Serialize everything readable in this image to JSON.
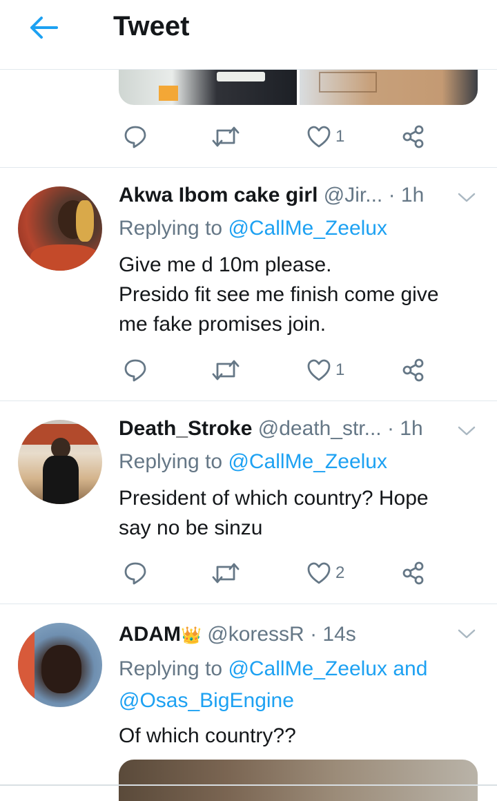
{
  "header": {
    "title": "Tweet"
  },
  "top_tweet": {
    "likes": "1"
  },
  "replies": [
    {
      "display_name": "Akwa Ibom cake girl",
      "handle": "@Jir...",
      "time": "· 1h",
      "replying_prefix": "Replying to",
      "mentions": [
        "@CallMe_Zeelux"
      ],
      "text_lines": [
        "Give me d 10m please.",
        "Presido fit see me finish come give",
        "me fake promises join."
      ],
      "likes": "1"
    },
    {
      "display_name": "Death_Stroke",
      "handle": "@death_str...",
      "time": "· 1h",
      "replying_prefix": "Replying to",
      "mentions": [
        "@CallMe_Zeelux"
      ],
      "text_lines": [
        "President of which country? Hope",
        "say no be sinzu"
      ],
      "likes": "2"
    },
    {
      "display_name": "ADAM",
      "badge": "👑",
      "handle": "@koressR",
      "time": "· 14s",
      "replying_prefix": "Replying to",
      "mentions": [
        "@CallMe_Zeelux",
        "@Osas_BigEngine"
      ],
      "mention_joiner": "and",
      "text_lines": [
        "Of which country??"
      ]
    }
  ],
  "colors": {
    "accent": "#1da1f2",
    "secondary_text": "#657786",
    "divider": "#e1e8ed"
  },
  "icons": {
    "back": "arrow-left-icon",
    "reply": "speech-bubble-icon",
    "retweet": "retweet-icon",
    "like": "heart-icon",
    "share": "share-icon",
    "more": "chevron-down-icon"
  }
}
